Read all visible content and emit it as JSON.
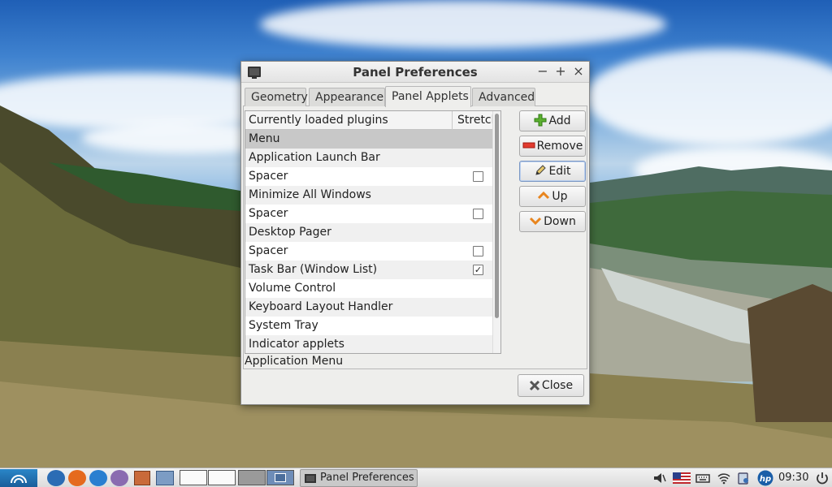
{
  "window": {
    "title": "Panel Preferences",
    "controls": {
      "minimize": "−",
      "maximize": "+",
      "close": "×"
    }
  },
  "tabs": [
    "Geometry",
    "Appearance",
    "Panel Applets",
    "Advanced"
  ],
  "active_tab": "Panel Applets",
  "plugins": {
    "columns": [
      "Currently loaded plugins",
      "Stretch"
    ],
    "rows": [
      {
        "name": "Menu",
        "stretch": null,
        "selected": true
      },
      {
        "name": "Application Launch Bar",
        "stretch": null
      },
      {
        "name": "Spacer",
        "stretch": false
      },
      {
        "name": "Minimize All Windows",
        "stretch": null
      },
      {
        "name": "Spacer",
        "stretch": false
      },
      {
        "name": "Desktop Pager",
        "stretch": null
      },
      {
        "name": "Spacer",
        "stretch": false
      },
      {
        "name": "Task Bar (Window List)",
        "stretch": true
      },
      {
        "name": "Volume Control",
        "stretch": null
      },
      {
        "name": "Keyboard Layout Handler",
        "stretch": null
      },
      {
        "name": "System Tray",
        "stretch": null
      },
      {
        "name": "Indicator applets",
        "stretch": null
      }
    ],
    "description": "Application Menu"
  },
  "buttons": {
    "add": "Add",
    "remove": "Remove",
    "edit": "Edit",
    "up": "Up",
    "down": "Down",
    "close": "Close"
  },
  "taskbar": {
    "task_title": "Panel Preferences",
    "clock": "09:30",
    "icons": [
      "start-menu-icon",
      "web-browser-icon",
      "firefox-icon",
      "thunderbird-icon",
      "pidgin-icon",
      "file-manager-icon",
      "show-desktop-icon",
      "volume-icon",
      "us-flag-icon",
      "keyboard-icon",
      "network-icon",
      "battery-icon",
      "hp-icon",
      "power-icon"
    ]
  },
  "colors": {
    "selection": "#c8c8c8",
    "accent": "#6e8db8"
  }
}
